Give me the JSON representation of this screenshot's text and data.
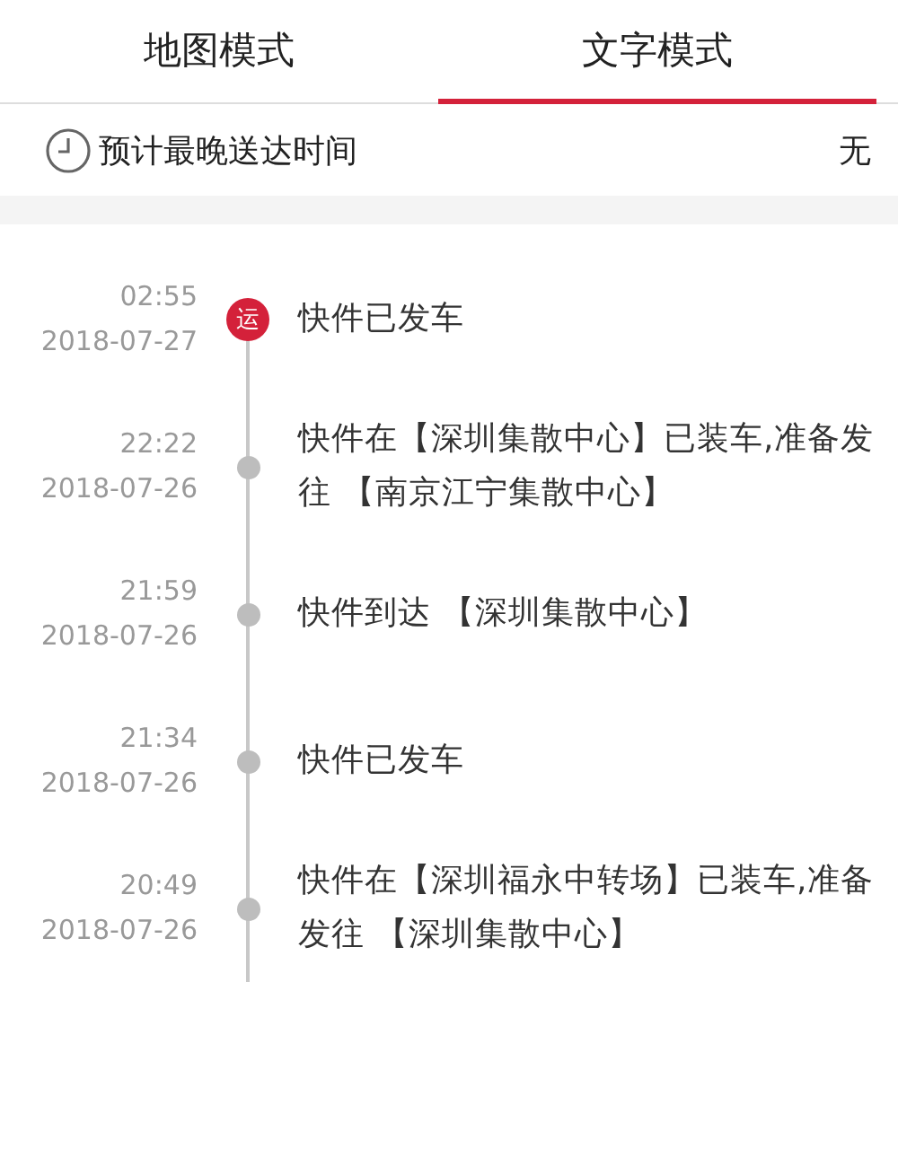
{
  "tabs": [
    {
      "label": "地图模式",
      "selected": false
    },
    {
      "label": "文字模式",
      "selected": true
    }
  ],
  "estimate": {
    "label": "预计最晚送达时间",
    "value": "无"
  },
  "events": [
    {
      "kind": "current",
      "badge": "运",
      "time": "02:55",
      "date": "2018-07-27",
      "text": "快件已发车"
    },
    {
      "kind": "past",
      "time": "22:22",
      "date": "2018-07-26",
      "text": "快件在【深圳集散中心】已装车,准备发往 【南京江宁集散中心】"
    },
    {
      "kind": "past",
      "time": "21:59",
      "date": "2018-07-26",
      "text": "快件到达 【深圳集散中心】"
    },
    {
      "kind": "past",
      "time": "21:34",
      "date": "2018-07-26",
      "text": "快件已发车"
    },
    {
      "kind": "past",
      "time": "20:49",
      "date": "2018-07-26",
      "text": "快件在【深圳福永中转场】已装车,准备发往 【深圳集散中心】"
    }
  ]
}
